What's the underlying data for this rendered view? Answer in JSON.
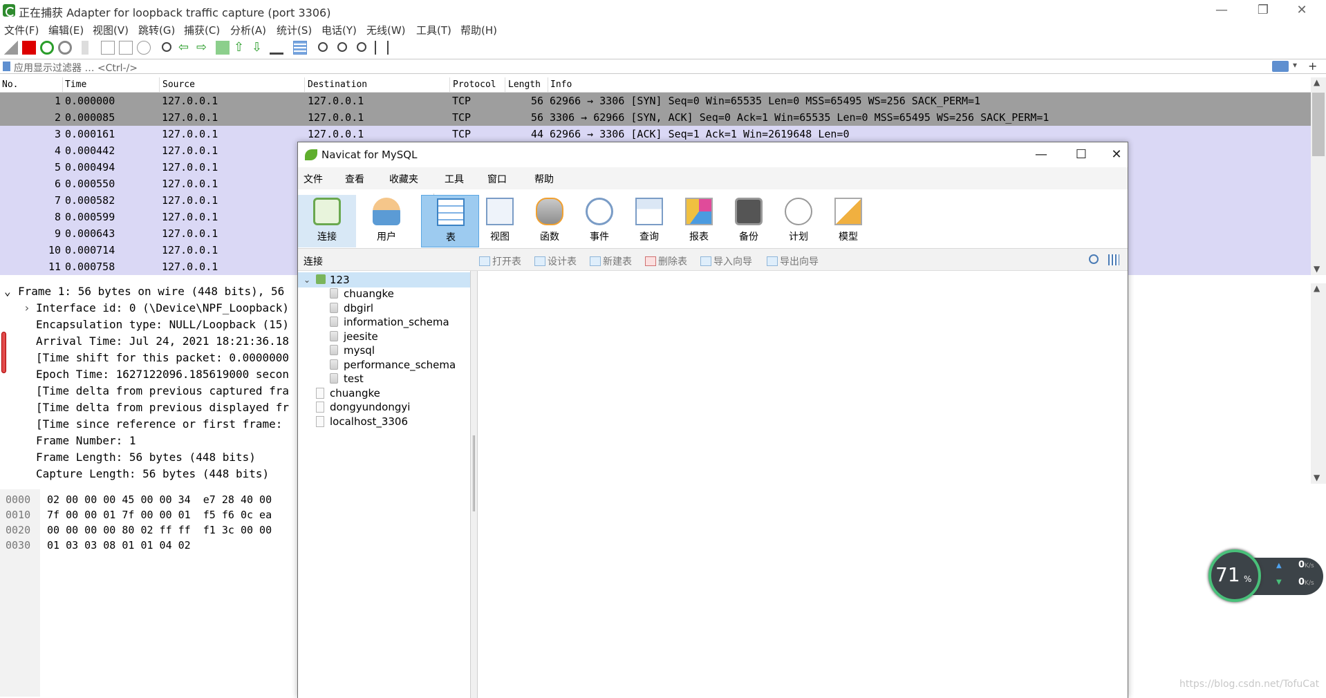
{
  "wireshark": {
    "title": "正在捕获 Adapter for loopback traffic capture (port 3306)",
    "window_controls": {
      "minimize": "—",
      "restore": "❐",
      "close": "✕"
    },
    "menu": [
      "文件(F)",
      "编辑(E)",
      "视图(V)",
      "跳转(G)",
      "捕获(C)",
      "分析(A)",
      "统计(S)",
      "电话(Y)",
      "无线(W)",
      "工具(T)",
      "帮助(H)"
    ],
    "filter": {
      "label": "应用显示过滤器 … <Ctrl-/>"
    },
    "columns": [
      "No.",
      "Time",
      "Source",
      "Destination",
      "Protocol",
      "Length",
      "Info"
    ],
    "packets": [
      {
        "no": "1",
        "time": "0.000000",
        "src": "127.0.0.1",
        "dst": "127.0.0.1",
        "proto": "TCP",
        "len": "56",
        "info": "62966 → 3306 [SYN] Seq=0 Win=65535 Len=0 MSS=65495 WS=256 SACK_PERM=1"
      },
      {
        "no": "2",
        "time": "0.000085",
        "src": "127.0.0.1",
        "dst": "127.0.0.1",
        "proto": "TCP",
        "len": "56",
        "info": "3306 → 62966 [SYN, ACK] Seq=0 Ack=1 Win=65535 Len=0 MSS=65495 WS=256 SACK_PERM=1"
      },
      {
        "no": "3",
        "time": "0.000161",
        "src": "127.0.0.1",
        "dst": "127.0.0.1",
        "proto": "TCP",
        "len": "44",
        "info": "62966 → 3306 [ACK] Seq=1 Ack=1 Win=2619648 Len=0"
      },
      {
        "no": "4",
        "time": "0.000442",
        "src": "127.0.0.1"
      },
      {
        "no": "5",
        "time": "0.000494",
        "src": "127.0.0.1"
      },
      {
        "no": "6",
        "time": "0.000550",
        "src": "127.0.0.1"
      },
      {
        "no": "7",
        "time": "0.000582",
        "src": "127.0.0.1"
      },
      {
        "no": "8",
        "time": "0.000599",
        "src": "127.0.0.1"
      },
      {
        "no": "9",
        "time": "0.000643",
        "src": "127.0.0.1"
      },
      {
        "no": "10",
        "time": "0.000714",
        "src": "127.0.0.1"
      },
      {
        "no": "11",
        "time": "0.000758",
        "src": "127.0.0.1"
      }
    ],
    "detail": [
      "Frame 1: 56 bytes on wire (448 bits), 56",
      "Interface id: 0 (\\Device\\NPF_Loopback)",
      "Encapsulation type: NULL/Loopback (15)",
      "Arrival Time: Jul 24, 2021 18:21:36.18",
      "[Time shift for this packet: 0.0000000",
      "Epoch Time: 1627122096.185619000 secon",
      "[Time delta from previous captured fra",
      "[Time delta from previous displayed fr",
      "[Time since reference or first frame: ",
      "Frame Number: 1",
      "Frame Length: 56 bytes (448 bits)",
      "Capture Length: 56 bytes (448 bits)"
    ],
    "hex": [
      {
        "offset": "0000",
        "bytes": "02 00 00 00 45 00 00 34  e7 28 40 00"
      },
      {
        "offset": "0010",
        "bytes": "7f 00 00 01 7f 00 00 01  f5 f6 0c ea"
      },
      {
        "offset": "0020",
        "bytes": "00 00 00 00 80 02 ff ff  f1 3c 00 00"
      },
      {
        "offset": "0030",
        "bytes": "01 03 03 08 01 01 04 02"
      }
    ]
  },
  "navicat": {
    "title": "Navicat for MySQL",
    "window_controls": {
      "minimize": "—",
      "maximize": "☐",
      "close": "✕"
    },
    "menu": [
      "文件",
      "查看",
      "收藏夹",
      "工具",
      "窗口",
      "帮助"
    ],
    "ribbon": [
      {
        "label": "连接",
        "icon": "connection-icon"
      },
      {
        "label": "用户",
        "icon": "user-icon"
      },
      {
        "label": "表",
        "icon": "table-icon"
      },
      {
        "label": "视图",
        "icon": "view-icon"
      },
      {
        "label": "函数",
        "icon": "function-icon"
      },
      {
        "label": "事件",
        "icon": "event-icon"
      },
      {
        "label": "查询",
        "icon": "query-icon"
      },
      {
        "label": "报表",
        "icon": "report-icon"
      },
      {
        "label": "备份",
        "icon": "backup-icon"
      },
      {
        "label": "计划",
        "icon": "schedule-icon"
      },
      {
        "label": "模型",
        "icon": "model-icon"
      }
    ],
    "subbar_label": "连接",
    "subbar_actions": [
      "打开表",
      "设计表",
      "新建表",
      "删除表",
      "导入向导",
      "导出向导"
    ],
    "tree": {
      "root": "123",
      "databases": [
        "chuangke",
        "dbgirl",
        "information_schema",
        "jeesite",
        "mysql",
        "performance_schema",
        "test"
      ],
      "connections": [
        "chuangke",
        "dongyundongyi",
        "localhost_3306"
      ]
    }
  },
  "speed_widget": {
    "percent": "71",
    "percent_sign": "%",
    "up_rate": "0",
    "down_rate": "0",
    "unit": "K/s"
  },
  "watermark": "https://blog.csdn.net/TofuCat",
  "colors": {
    "packet_row": "#dad8f5",
    "packet_selected": "#9e9e9e",
    "ribbon_active": "#9dcbf0",
    "tree_selected": "#cce4f7"
  }
}
